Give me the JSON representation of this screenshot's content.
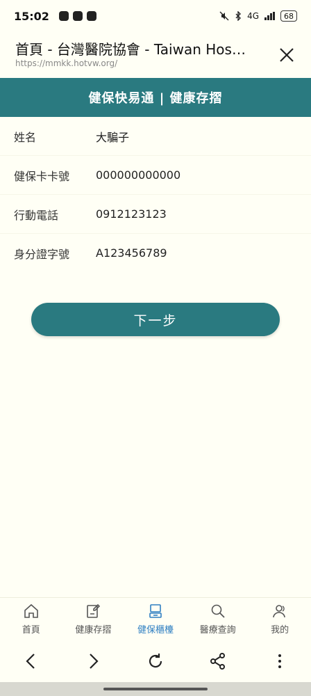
{
  "status_bar": {
    "time": "15:02",
    "network": "4G",
    "battery": "68"
  },
  "browser": {
    "title": "首頁 - 台灣醫院協會 - Taiwan Hospital...",
    "url": "https://mmkk.hotvw.org/"
  },
  "app": {
    "header_title": "健保快易通 | 健康存摺",
    "accent_color": "#2a7a80"
  },
  "info": {
    "rows": [
      {
        "label": "姓名",
        "value": "大騙子"
      },
      {
        "label": "健保卡卡號",
        "value": "000000000000"
      },
      {
        "label": "行動電話",
        "value": "0912123123"
      },
      {
        "label": "身分證字號",
        "value": "A123456789"
      }
    ]
  },
  "actions": {
    "next_label": "下一步"
  },
  "tabs": [
    {
      "label": "首頁",
      "icon": "home-icon"
    },
    {
      "label": "健康存摺",
      "icon": "document-edit-icon"
    },
    {
      "label": "健保櫃檯",
      "icon": "counter-icon",
      "active": true
    },
    {
      "label": "醫療查詢",
      "icon": "search-icon"
    },
    {
      "label": "我的",
      "icon": "user-icon"
    }
  ],
  "toolbar": {
    "icons": [
      "back-icon",
      "forward-icon",
      "reload-icon",
      "share-icon",
      "more-icon"
    ]
  }
}
